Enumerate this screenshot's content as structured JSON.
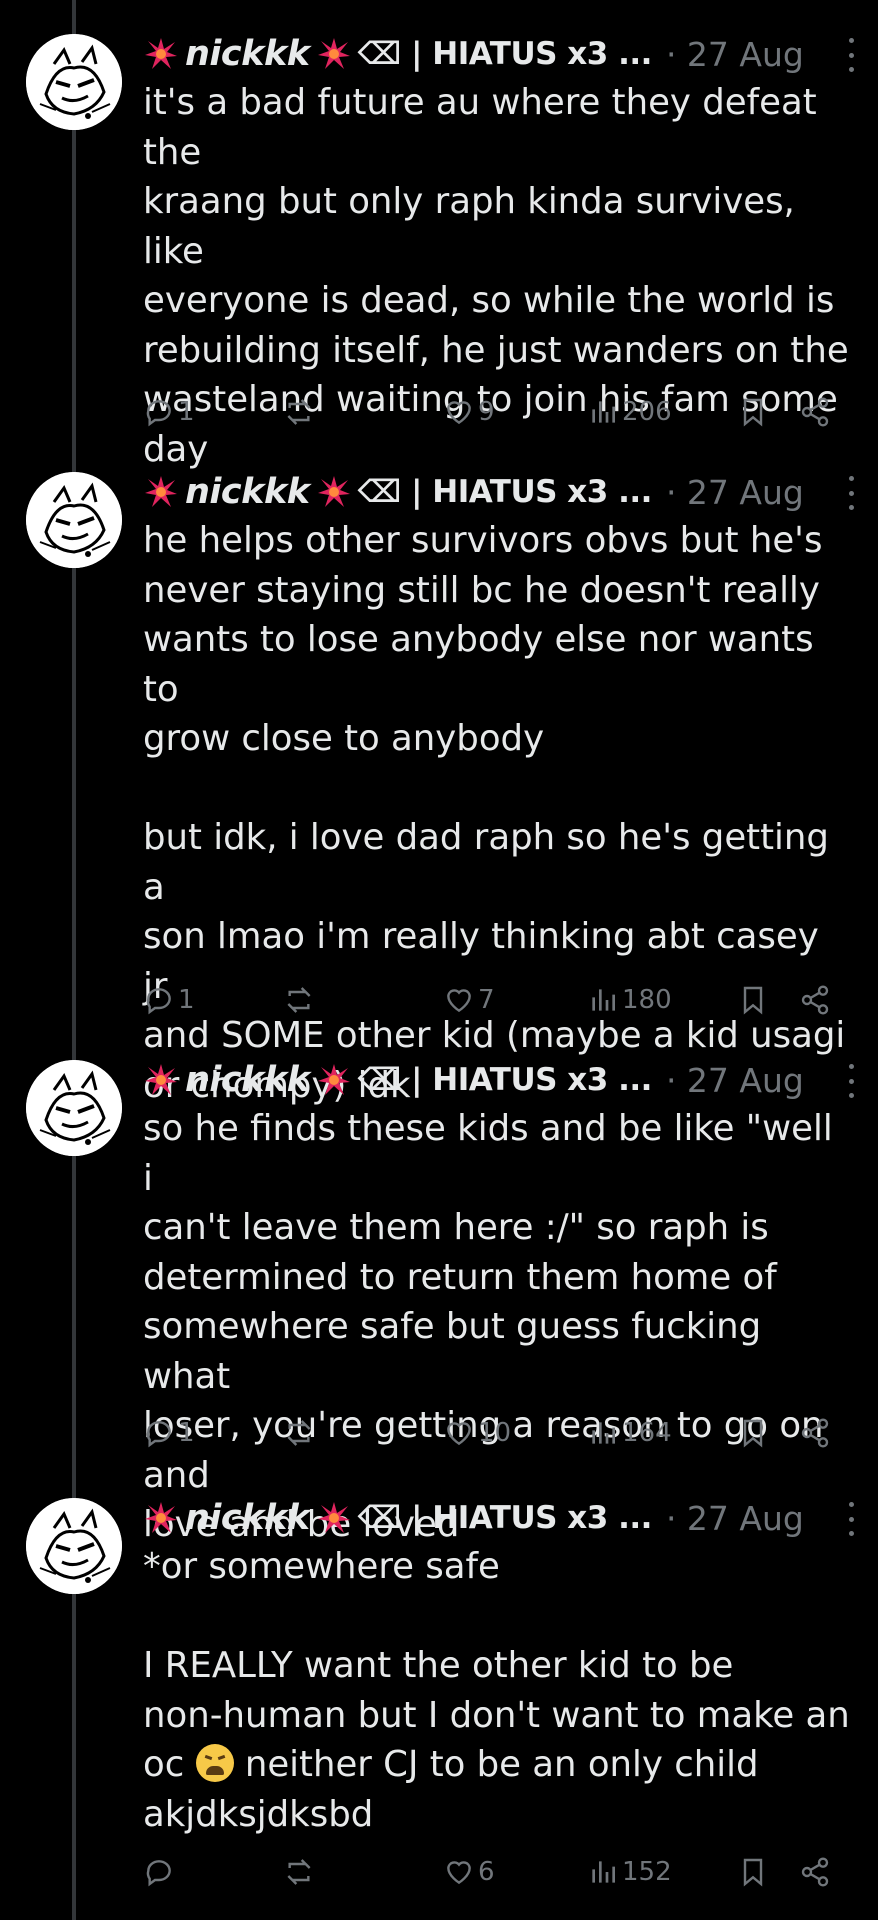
{
  "author": {
    "name": "nickkk",
    "tag": "⌫ | HIATUS x3 ...",
    "date": "· 27 Aug",
    "spark_icon": "sparkle-burst-icon",
    "accent_color": "#e0245e"
  },
  "posts": [
    {
      "text": "it's a bad future au where they defeat the\nkraang but only raph kinda survives, like\neveryone is dead, so while the world is\nrebuilding itself, he just wanders on the\nwasteland waiting to join his fam some\nday",
      "replies": "1",
      "reposts": "",
      "likes": "9",
      "views": "206"
    },
    {
      "text": "he helps other survivors obvs but he's\nnever staying still bc he doesn't really\nwants to lose anybody else nor wants to\ngrow close to anybody\n\nbut idk, i love dad raph so he's getting a\nson lmao i'm really thinking abt casey jr\nand SOME other kid (maybe a kid usagi\nor chompy) idk",
      "replies": "1",
      "reposts": "",
      "likes": "7",
      "views": "180"
    },
    {
      "text": "so he finds these kids and be like \"well i\ncan't leave them here :/\" so raph is\ndetermined to return them home of\nsomewhere safe but guess fucking what\nloser, you're getting a reason to go on and\nlove and be loved",
      "replies": "1",
      "reposts": "",
      "likes": "10",
      "views": "164"
    },
    {
      "text_before_emoji": "*or somewhere safe\n\nI REALLY want the other kid to be\nnon-human but I don't want to make an\noc ",
      "emoji": "weary-face-emoji",
      "text_after_emoji": " neither CJ to be an only child\nakjdksjdksbd",
      "replies": "",
      "reposts": "",
      "likes": "6",
      "views": "152"
    }
  ]
}
